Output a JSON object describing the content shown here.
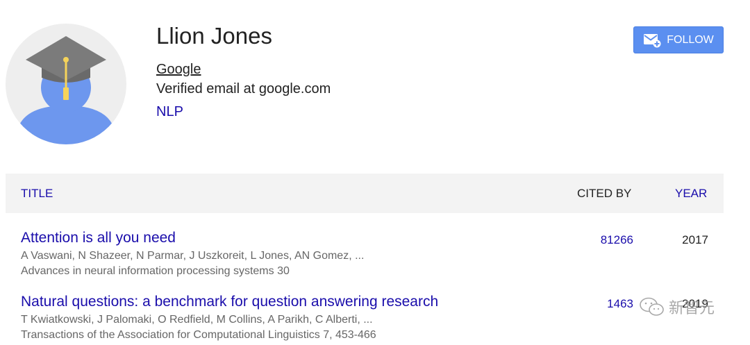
{
  "profile": {
    "name": "Llion Jones",
    "affiliation": "Google",
    "email": "Verified email at google.com",
    "interests": [
      "NLP"
    ]
  },
  "follow_button": {
    "label": "FOLLOW",
    "icon": "mail-plus-icon",
    "color": "#5b8ff0"
  },
  "table": {
    "headers": {
      "title": "TITLE",
      "cited_by": "CITED BY",
      "year": "YEAR"
    },
    "rows": [
      {
        "title": "Attention is all you need",
        "authors": "A Vaswani, N Shazeer, N Parmar, J Uszkoreit, L Jones, AN Gomez, ...",
        "venue": "Advances in neural information processing systems 30",
        "cited_by": "81266",
        "year": "2017"
      },
      {
        "title": "Natural questions: a benchmark for question answering research",
        "authors": "T Kwiatkowski, J Palomaki, O Redfield, M Collins, A Parikh, C Alberti, ...",
        "venue": "Transactions of the Association for Computational Linguistics 7, 453-466",
        "cited_by": "1463",
        "year": "2019"
      }
    ]
  },
  "watermark": {
    "text": "新智元",
    "icon": "wechat-icon"
  },
  "colors": {
    "link": "#1a0dab",
    "header_bg": "#f3f3f3",
    "avatar_blue": "#6d97ee",
    "cap_gray": "#7b7b7b",
    "tassel": "#f5d35a"
  }
}
